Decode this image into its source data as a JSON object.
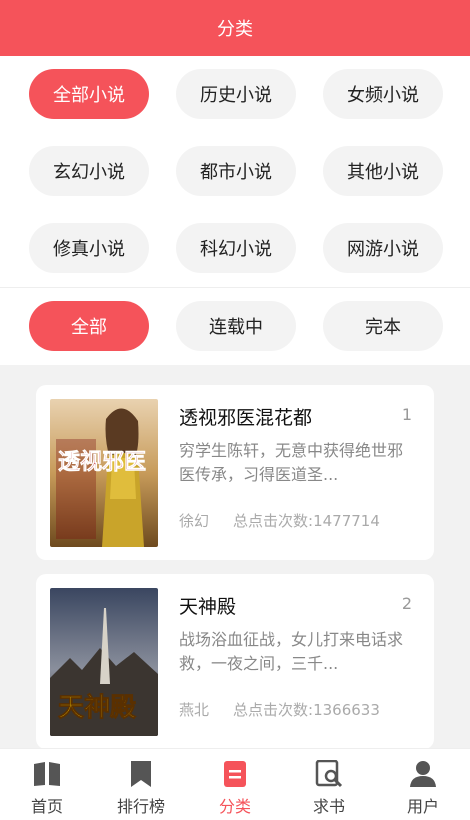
{
  "header": {
    "title": "分类"
  },
  "categories": [
    {
      "label": "全部小说",
      "active": true
    },
    {
      "label": "历史小说",
      "active": false
    },
    {
      "label": "女频小说",
      "active": false
    },
    {
      "label": "玄幻小说",
      "active": false
    },
    {
      "label": "都市小说",
      "active": false
    },
    {
      "label": "其他小说",
      "active": false
    },
    {
      "label": "修真小说",
      "active": false
    },
    {
      "label": "科幻小说",
      "active": false
    },
    {
      "label": "网游小说",
      "active": false
    }
  ],
  "statuses": [
    {
      "label": "全部",
      "active": true
    },
    {
      "label": "连载中",
      "active": false
    },
    {
      "label": "完本",
      "active": false
    }
  ],
  "books": [
    {
      "title": "透视邪医混花都",
      "rank": "1",
      "description": "穷学生陈轩，无意中获得绝世邪医传承，习得医道圣...",
      "category": "徐幻",
      "clicks": "总点击次数:1477714",
      "cover_text": "透视邪医"
    },
    {
      "title": "天神殿",
      "rank": "2",
      "description": "战场浴血征战，女儿打来电话求救，一夜之间，三千...",
      "category": "燕北",
      "clicks": "总点击次数:1366633",
      "cover_text": "天神殿"
    }
  ],
  "tabbar": [
    {
      "label": "首页",
      "icon": "book-open-icon",
      "active": false
    },
    {
      "label": "排行榜",
      "icon": "bookmark-icon",
      "active": false
    },
    {
      "label": "分类",
      "icon": "category-icon",
      "active": true
    },
    {
      "label": "求书",
      "icon": "search-book-icon",
      "active": false
    },
    {
      "label": "用户",
      "icon": "user-icon",
      "active": false
    }
  ],
  "colors": {
    "accent": "#f5535a",
    "chip_bg": "#f3f3f3",
    "page_bg": "#f2f2f2"
  }
}
